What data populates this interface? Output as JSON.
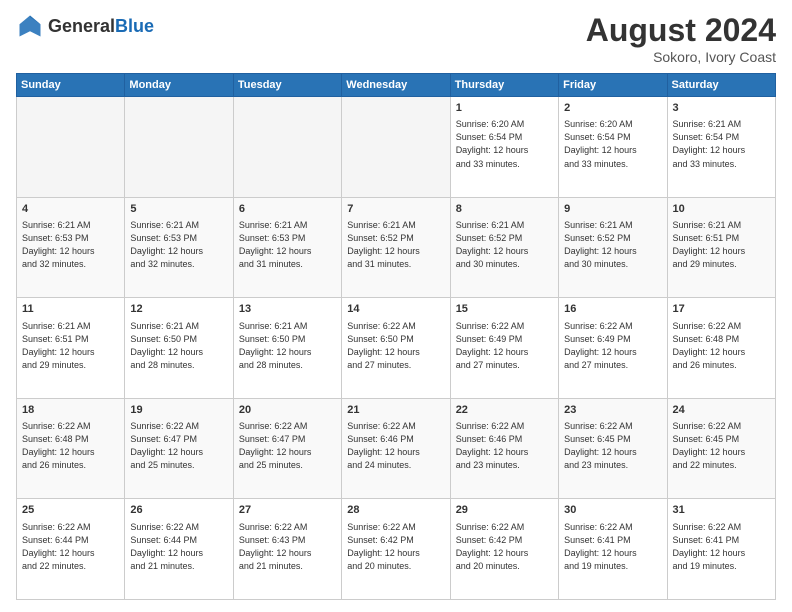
{
  "header": {
    "logo_general": "General",
    "logo_blue": "Blue",
    "title": "August 2024",
    "location": "Sokoro, Ivory Coast"
  },
  "weekdays": [
    "Sunday",
    "Monday",
    "Tuesday",
    "Wednesday",
    "Thursday",
    "Friday",
    "Saturday"
  ],
  "weeks": [
    [
      {
        "day": "",
        "info": ""
      },
      {
        "day": "",
        "info": ""
      },
      {
        "day": "",
        "info": ""
      },
      {
        "day": "",
        "info": ""
      },
      {
        "day": "1",
        "info": "Sunrise: 6:20 AM\nSunset: 6:54 PM\nDaylight: 12 hours\nand 33 minutes."
      },
      {
        "day": "2",
        "info": "Sunrise: 6:20 AM\nSunset: 6:54 PM\nDaylight: 12 hours\nand 33 minutes."
      },
      {
        "day": "3",
        "info": "Sunrise: 6:21 AM\nSunset: 6:54 PM\nDaylight: 12 hours\nand 33 minutes."
      }
    ],
    [
      {
        "day": "4",
        "info": "Sunrise: 6:21 AM\nSunset: 6:53 PM\nDaylight: 12 hours\nand 32 minutes."
      },
      {
        "day": "5",
        "info": "Sunrise: 6:21 AM\nSunset: 6:53 PM\nDaylight: 12 hours\nand 32 minutes."
      },
      {
        "day": "6",
        "info": "Sunrise: 6:21 AM\nSunset: 6:53 PM\nDaylight: 12 hours\nand 31 minutes."
      },
      {
        "day": "7",
        "info": "Sunrise: 6:21 AM\nSunset: 6:52 PM\nDaylight: 12 hours\nand 31 minutes."
      },
      {
        "day": "8",
        "info": "Sunrise: 6:21 AM\nSunset: 6:52 PM\nDaylight: 12 hours\nand 30 minutes."
      },
      {
        "day": "9",
        "info": "Sunrise: 6:21 AM\nSunset: 6:52 PM\nDaylight: 12 hours\nand 30 minutes."
      },
      {
        "day": "10",
        "info": "Sunrise: 6:21 AM\nSunset: 6:51 PM\nDaylight: 12 hours\nand 29 minutes."
      }
    ],
    [
      {
        "day": "11",
        "info": "Sunrise: 6:21 AM\nSunset: 6:51 PM\nDaylight: 12 hours\nand 29 minutes."
      },
      {
        "day": "12",
        "info": "Sunrise: 6:21 AM\nSunset: 6:50 PM\nDaylight: 12 hours\nand 28 minutes."
      },
      {
        "day": "13",
        "info": "Sunrise: 6:21 AM\nSunset: 6:50 PM\nDaylight: 12 hours\nand 28 minutes."
      },
      {
        "day": "14",
        "info": "Sunrise: 6:22 AM\nSunset: 6:50 PM\nDaylight: 12 hours\nand 27 minutes."
      },
      {
        "day": "15",
        "info": "Sunrise: 6:22 AM\nSunset: 6:49 PM\nDaylight: 12 hours\nand 27 minutes."
      },
      {
        "day": "16",
        "info": "Sunrise: 6:22 AM\nSunset: 6:49 PM\nDaylight: 12 hours\nand 27 minutes."
      },
      {
        "day": "17",
        "info": "Sunrise: 6:22 AM\nSunset: 6:48 PM\nDaylight: 12 hours\nand 26 minutes."
      }
    ],
    [
      {
        "day": "18",
        "info": "Sunrise: 6:22 AM\nSunset: 6:48 PM\nDaylight: 12 hours\nand 26 minutes."
      },
      {
        "day": "19",
        "info": "Sunrise: 6:22 AM\nSunset: 6:47 PM\nDaylight: 12 hours\nand 25 minutes."
      },
      {
        "day": "20",
        "info": "Sunrise: 6:22 AM\nSunset: 6:47 PM\nDaylight: 12 hours\nand 25 minutes."
      },
      {
        "day": "21",
        "info": "Sunrise: 6:22 AM\nSunset: 6:46 PM\nDaylight: 12 hours\nand 24 minutes."
      },
      {
        "day": "22",
        "info": "Sunrise: 6:22 AM\nSunset: 6:46 PM\nDaylight: 12 hours\nand 23 minutes."
      },
      {
        "day": "23",
        "info": "Sunrise: 6:22 AM\nSunset: 6:45 PM\nDaylight: 12 hours\nand 23 minutes."
      },
      {
        "day": "24",
        "info": "Sunrise: 6:22 AM\nSunset: 6:45 PM\nDaylight: 12 hours\nand 22 minutes."
      }
    ],
    [
      {
        "day": "25",
        "info": "Sunrise: 6:22 AM\nSunset: 6:44 PM\nDaylight: 12 hours\nand 22 minutes."
      },
      {
        "day": "26",
        "info": "Sunrise: 6:22 AM\nSunset: 6:44 PM\nDaylight: 12 hours\nand 21 minutes."
      },
      {
        "day": "27",
        "info": "Sunrise: 6:22 AM\nSunset: 6:43 PM\nDaylight: 12 hours\nand 21 minutes."
      },
      {
        "day": "28",
        "info": "Sunrise: 6:22 AM\nSunset: 6:42 PM\nDaylight: 12 hours\nand 20 minutes."
      },
      {
        "day": "29",
        "info": "Sunrise: 6:22 AM\nSunset: 6:42 PM\nDaylight: 12 hours\nand 20 minutes."
      },
      {
        "day": "30",
        "info": "Sunrise: 6:22 AM\nSunset: 6:41 PM\nDaylight: 12 hours\nand 19 minutes."
      },
      {
        "day": "31",
        "info": "Sunrise: 6:22 AM\nSunset: 6:41 PM\nDaylight: 12 hours\nand 19 minutes."
      }
    ]
  ]
}
